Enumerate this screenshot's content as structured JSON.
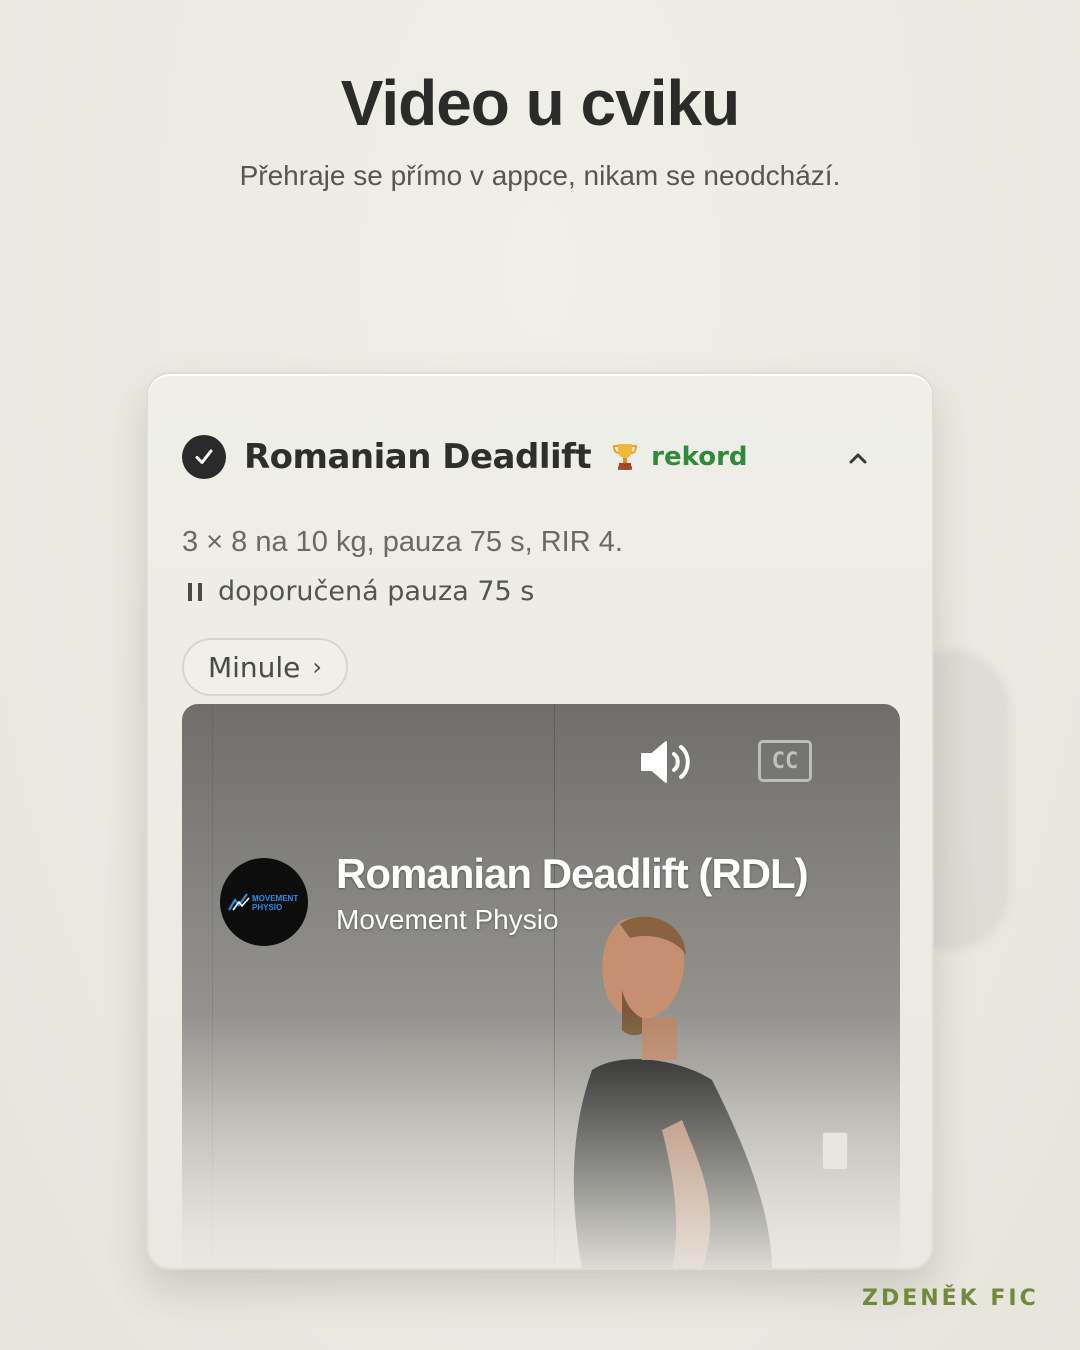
{
  "header": {
    "title": "Video u cviku",
    "subtitle": "Přehraje se přímo v appce, nikam se neodchází."
  },
  "card": {
    "exercise_name": "Romanian Deadlift",
    "record_label": "rekord",
    "prescription": "3 × 8 na 10 kg, pauza 75 s, RIR 4.",
    "rest_text": "doporučená pauza 75 s",
    "previous_label": "Minule",
    "previous_chevron": "›",
    "icons": {
      "check": "check-circle-icon",
      "trophy": "trophy-icon",
      "collapse": "chevron-up-icon",
      "pause": "pause-icon"
    }
  },
  "video": {
    "title": "Romanian Deadlift (RDL)",
    "channel": "Movement Physio",
    "channel_logo": "MOVEMENT PHYSIO",
    "cc_label": "CC",
    "icons": {
      "volume": "volume-icon",
      "captions": "cc-icon"
    }
  },
  "watermark": "ZDENĚK FIC",
  "colors": {
    "background": "#ebeae2",
    "record": "#2f8a3a",
    "watermark": "#6f8a3c",
    "text_dark": "#2e2e2c"
  }
}
